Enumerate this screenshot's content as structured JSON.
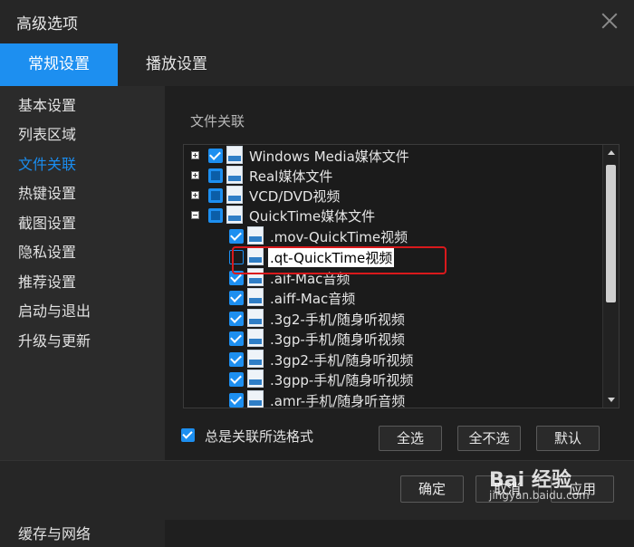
{
  "window": {
    "title": "高级选项"
  },
  "tabs": [
    {
      "label": "常规设置",
      "active": true
    },
    {
      "label": "播放设置",
      "active": false
    }
  ],
  "sidebar": {
    "items": [
      {
        "label": "基本设置"
      },
      {
        "label": "列表区域"
      },
      {
        "label": "文件关联",
        "active": true
      },
      {
        "label": "热键设置"
      },
      {
        "label": "截图设置"
      },
      {
        "label": "隐私设置"
      },
      {
        "label": "推荐设置"
      },
      {
        "label": "启动与退出"
      },
      {
        "label": "升级与更新"
      }
    ],
    "bottom_item": "缓存与网络"
  },
  "main": {
    "section_title": "文件关联",
    "tree": [
      {
        "label": "Windows Media媒体文件",
        "expander": "plus",
        "check": "checked",
        "level": 0
      },
      {
        "label": "Real媒体文件",
        "expander": "plus",
        "check": "partial",
        "level": 0
      },
      {
        "label": "VCD/DVD视频",
        "expander": "plus",
        "check": "partial",
        "level": 0
      },
      {
        "label": "QuickTime媒体文件",
        "expander": "minus",
        "check": "partial",
        "level": 0
      },
      {
        "label": ".mov-QuickTime视频",
        "check": "checked",
        "level": 1
      },
      {
        "label": ".qt-QuickTime视频",
        "check": "unchecked",
        "level": 1,
        "selected": true
      },
      {
        "label": ".aif-Mac音频",
        "check": "checked",
        "level": 1
      },
      {
        "label": ".aiff-Mac音频",
        "check": "checked",
        "level": 1
      },
      {
        "label": ".3g2-手机/随身听视频",
        "check": "checked",
        "level": 1
      },
      {
        "label": ".3gp-手机/随身听视频",
        "check": "checked",
        "level": 1
      },
      {
        "label": ".3gp2-手机/随身听视频",
        "check": "checked",
        "level": 1
      },
      {
        "label": ".3gpp-手机/随身听视频",
        "check": "checked",
        "level": 1
      },
      {
        "label": ".amr-手机/随身听音频",
        "check": "checked",
        "level": 1
      }
    ],
    "always_associate_label": "总是关联所选格式",
    "always_associate_checked": true,
    "select_all": "全选",
    "select_none": "全不选",
    "default": "默认"
  },
  "footer": {
    "ok": "确定",
    "cancel": "取消",
    "apply": "应用"
  },
  "watermark": {
    "line1": "Bai 经验",
    "line2": "jingyan.baidu.com"
  },
  "colors": {
    "accent": "#1d8ff0",
    "highlight_border": "#d9191c"
  }
}
